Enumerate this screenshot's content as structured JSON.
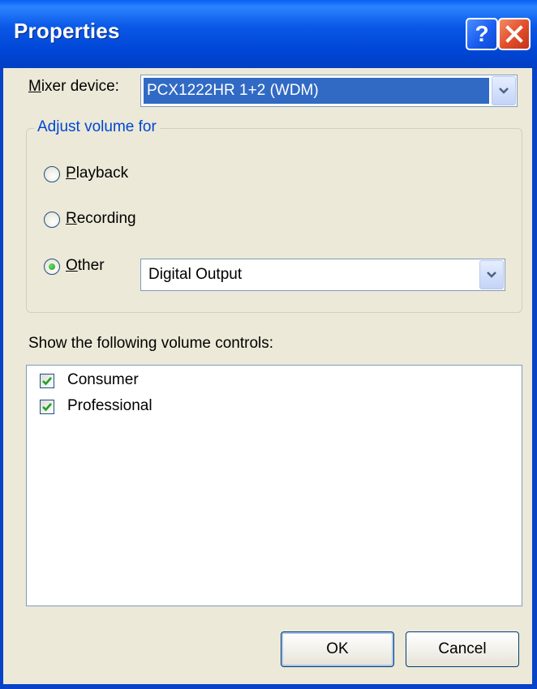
{
  "window": {
    "title": "Properties",
    "help_glyph": "?",
    "close_icon": "close-icon",
    "titlebar_color": "#0a58e8",
    "body_color": "#ece9d8"
  },
  "mixer": {
    "label_accel": "M",
    "label_rest": "ixer device:",
    "selected": "PCX1222HR 1+2 (WDM)"
  },
  "adjust_group": {
    "legend": "Adjust volume for",
    "options": [
      {
        "accel": "P",
        "rest": "layback",
        "checked": false
      },
      {
        "accel": "R",
        "rest": "ecording",
        "checked": false
      },
      {
        "accel": "O",
        "rest": "ther",
        "checked": true
      }
    ],
    "other_selected": "Digital Output"
  },
  "controls": {
    "label": "Show the following volume controls:",
    "items": [
      {
        "label": "Consumer",
        "checked": true
      },
      {
        "label": "Professional",
        "checked": true
      }
    ]
  },
  "buttons": {
    "ok": "OK",
    "cancel": "Cancel"
  }
}
